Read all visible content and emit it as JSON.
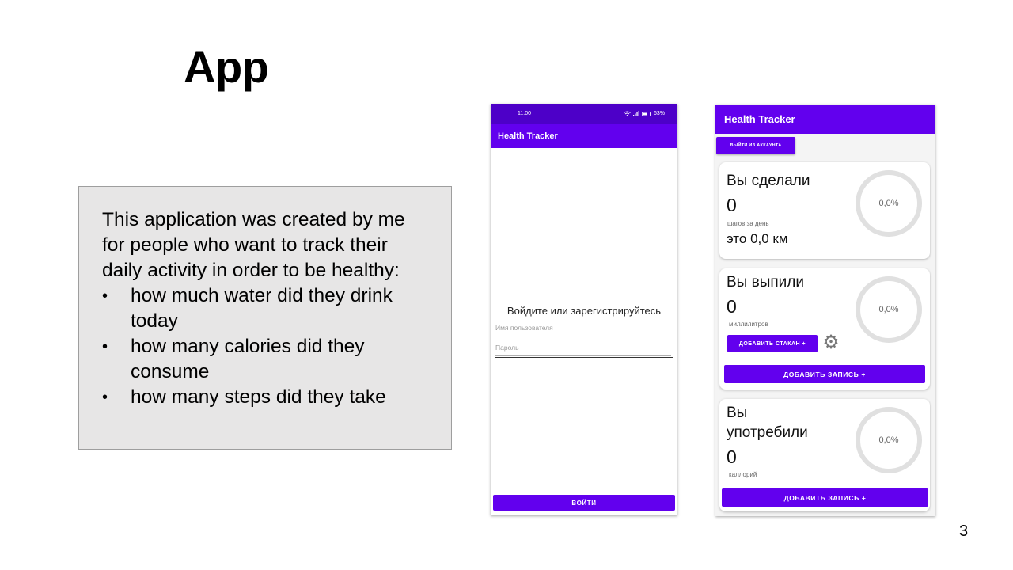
{
  "slide": {
    "title": "App",
    "description": "This application was created by me for people who want to track their daily activity in order to be healthy:",
    "bullets": [
      "how much water did they drink today",
      "how many calories did they consume",
      "how many steps did they take"
    ],
    "page_number": "3"
  },
  "login_screen": {
    "status_time": "11:00",
    "status_battery": "63%",
    "app_title": "Health Tracker",
    "prompt": "Войдите или зарегистрируйтесь",
    "username_placeholder": "Имя пользователя",
    "password_placeholder": "Пароль",
    "login_button": "ВОЙТИ"
  },
  "dashboard": {
    "app_title": "Health Tracker",
    "logout_button": "ВЫЙТИ ИЗ АККАУНТА",
    "steps": {
      "heading": "Вы сделали",
      "value": "0",
      "unit": "шагов за день",
      "distance": "это 0,0 км",
      "progress_label": "0,0%"
    },
    "water": {
      "heading": "Вы выпили",
      "value": "0",
      "unit": "миллилитров",
      "add_glass_button": "ДОБАВИТЬ СТАКАН +",
      "add_record_button": "ДОБАВИТЬ ЗАПИСЬ +",
      "progress_label": "0,0%"
    },
    "calories": {
      "heading_line1": "Вы",
      "heading_line2": "употребили",
      "value": "0",
      "unit": "каллорий",
      "add_record_button": "ДОБАВИТЬ ЗАПИСЬ +",
      "progress_label": "0,0%"
    }
  },
  "colors": {
    "primary": "#6200ee",
    "status_bar": "#4d00c8",
    "description_box": "#e7e6e6",
    "progress_ring": "#e0e0e0"
  },
  "icons": [
    "wifi-icon",
    "signal-icon",
    "battery-icon",
    "settings-gear-icon"
  ]
}
